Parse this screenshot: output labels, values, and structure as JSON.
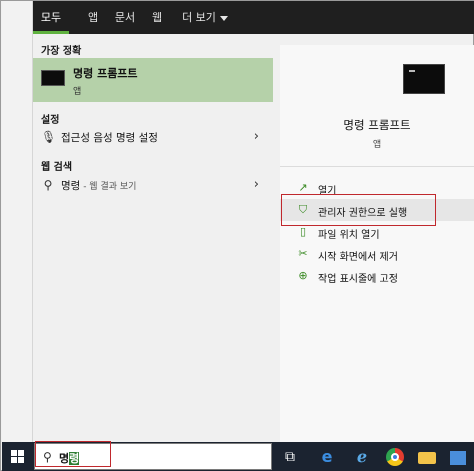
{
  "tabs": {
    "all": "모두",
    "apps": "앱",
    "documents": "문서",
    "web": "웹",
    "more": "더 보기"
  },
  "sections": {
    "best_match": "가장 정확",
    "settings": "설정",
    "web_search": "웹 검색"
  },
  "best_match": {
    "title": "명령 프롬프트",
    "subtitle": "앱"
  },
  "settings_item": {
    "label": "접근성 음성 명령 설정"
  },
  "web_item": {
    "term": "명령",
    "suffix": " - 웹 결과 보기"
  },
  "right": {
    "title": "명령 프롬프트",
    "subtitle": "앱",
    "actions": {
      "open": "열기",
      "run_as_admin": "관리자 권한으로 실행",
      "open_location": "파일 위치 열기",
      "unpin_start": "시작 화면에서 제거",
      "pin_taskbar": "작업 표시줄에 고정"
    }
  },
  "search": {
    "value_prefix": "명",
    "value_highlight": "령"
  },
  "icons": {
    "settings": "microphone-icon",
    "web": "search-icon",
    "taskbar": [
      "windows-logo-icon",
      "task-view-icon",
      "edge-icon",
      "internet-explorer-icon",
      "chrome-icon",
      "file-explorer-icon",
      "store-icon"
    ]
  },
  "colors": {
    "accent": "#5fb23f",
    "selection": "#b5d1a9",
    "taskbar": "#1b2330",
    "highlight_box": "#c0282d"
  }
}
